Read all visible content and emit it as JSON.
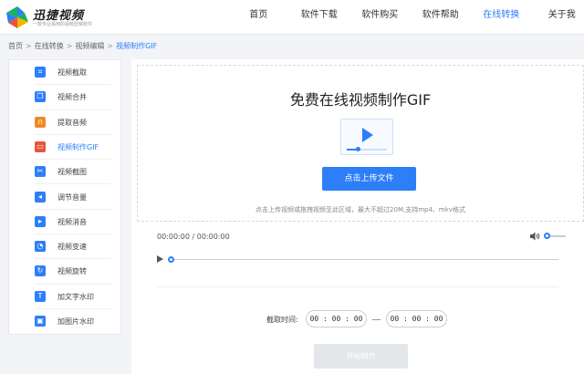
{
  "header": {
    "brand": "迅捷视频",
    "slogan": "一款专业易用的视频剪辑软件",
    "nav": [
      "首页",
      "软件下载",
      "软件购买",
      "软件帮助",
      "在线转换",
      "关于我"
    ],
    "active_nav": "在线转换"
  },
  "breadcrumb": {
    "items": [
      "首页",
      "在线转换",
      "视频编辑"
    ],
    "separator": ">",
    "current": "视频制作GIF"
  },
  "sidebar": {
    "items": [
      {
        "label": "视频截取",
        "icon": "crop-icon",
        "color": "#2d7ff9"
      },
      {
        "label": "视频合并",
        "icon": "merge-icon",
        "color": "#2d7ff9"
      },
      {
        "label": "提取音频",
        "icon": "headphones-icon",
        "color": "#f08a24"
      },
      {
        "label": "视频制作GIF",
        "icon": "gif-icon",
        "color": "#e8553b"
      },
      {
        "label": "视频截图",
        "icon": "scissors-icon",
        "color": "#2d7ff9"
      },
      {
        "label": "调节音量",
        "icon": "volume-icon",
        "color": "#2d7ff9"
      },
      {
        "label": "视频消音",
        "icon": "mute-video-icon",
        "color": "#2d7ff9"
      },
      {
        "label": "视频变速",
        "icon": "speedometer-icon",
        "color": "#2d7ff9"
      },
      {
        "label": "视频旋转",
        "icon": "rotate-icon",
        "color": "#2d7ff9"
      },
      {
        "label": "加文字水印",
        "icon": "text-watermark-icon",
        "color": "#2d7ff9"
      },
      {
        "label": "加图片水印",
        "icon": "image-watermark-icon",
        "color": "#2d7ff9"
      }
    ],
    "active_index": 3
  },
  "main": {
    "title": "免费在线视频制作GIF",
    "upload_button": "点击上传文件",
    "upload_hint": "点击上传视频或拖拽视频至此区域，最大不超过20M,支持mp4、mkv格式",
    "player": {
      "current_time": "00:00:00",
      "separator": "/",
      "total_time": "00:00:00",
      "progress": 0,
      "volume": 0
    },
    "crop": {
      "label": "截取时间:",
      "start": "00 : 00 : 00",
      "end": "00 : 00 : 00"
    },
    "make_button": "开始制作"
  },
  "colors": {
    "accent": "#2d7ff9",
    "disabled": "#e4e7ea"
  }
}
